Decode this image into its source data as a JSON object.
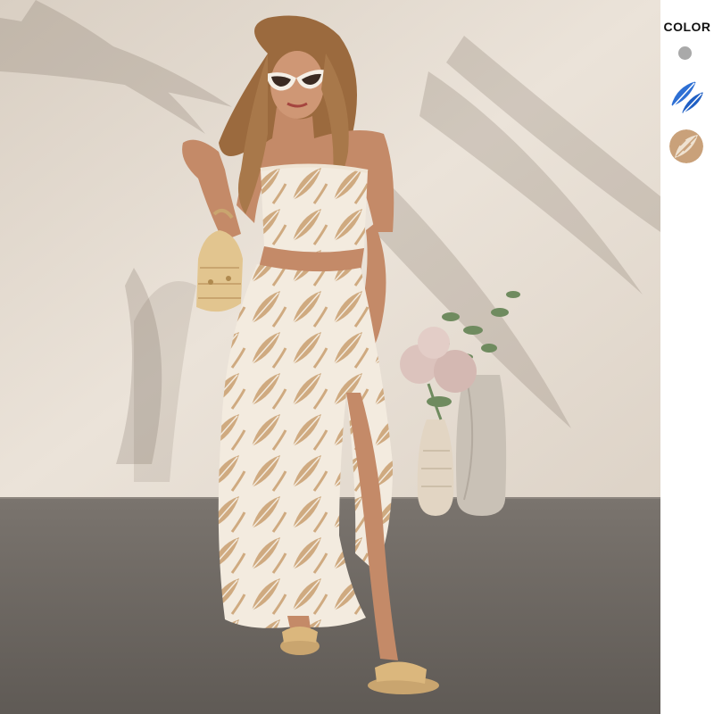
{
  "side_panel": {
    "title": "COLOR",
    "swatches": [
      {
        "name": "gray",
        "color": "#a9a9a9"
      },
      {
        "name": "blue-white-print",
        "color": "#2d6fd4"
      },
      {
        "name": "khaki-white-print",
        "color": "#c9a17a"
      }
    ]
  },
  "photo": {
    "background_wall": "#e6ddd2",
    "floor": "#6d6863",
    "garment_print_base": "#f3ebdf",
    "garment_print_leaf": "#cfaa80"
  }
}
